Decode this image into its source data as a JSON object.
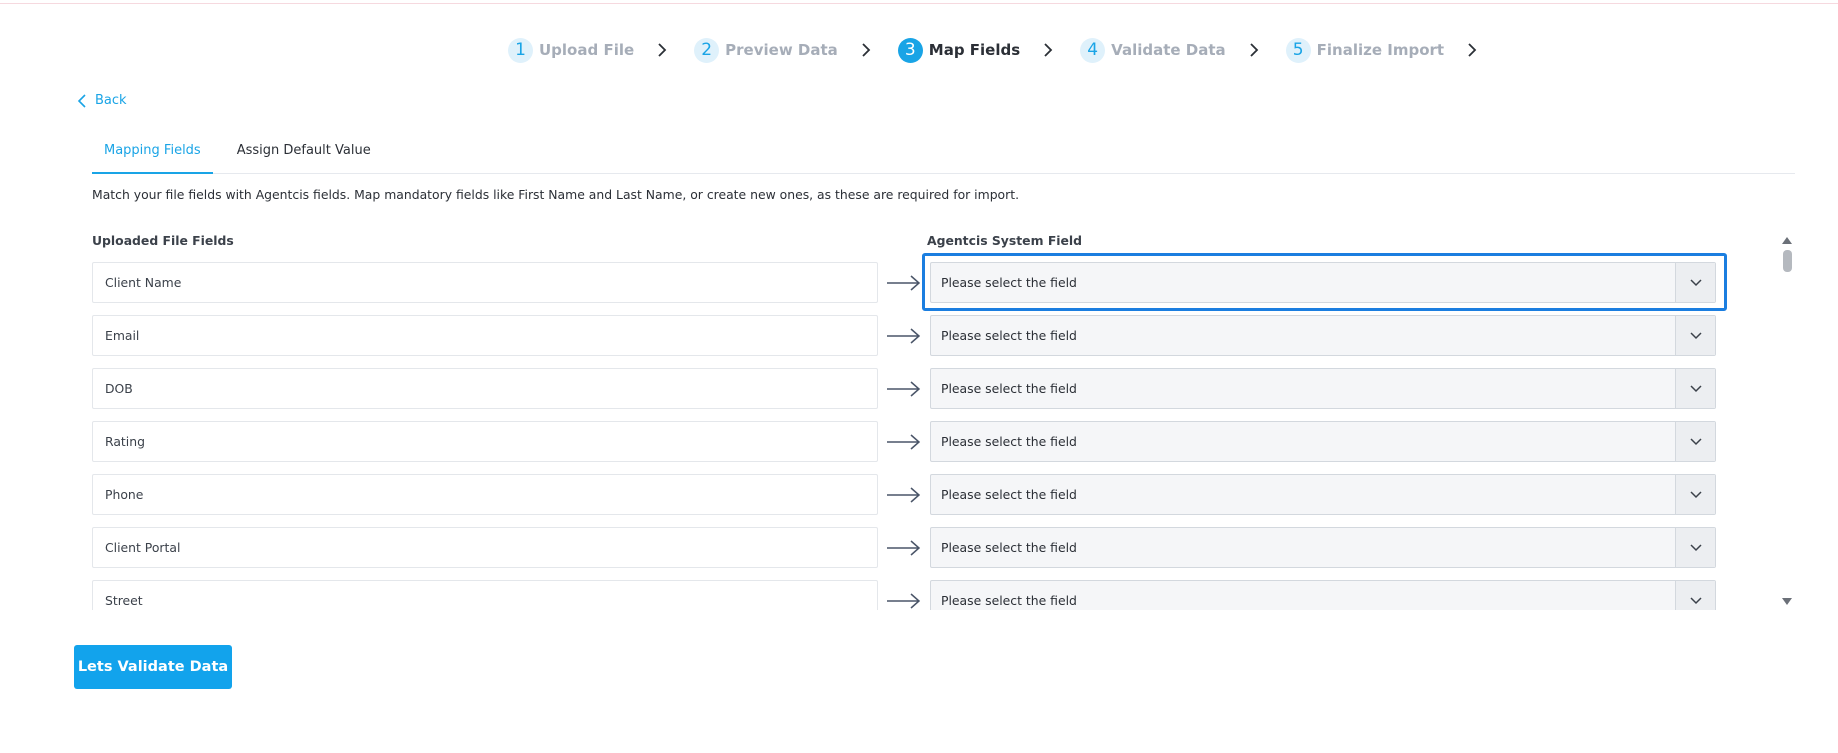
{
  "stepper": {
    "steps": [
      {
        "num": "1",
        "label": "Upload File"
      },
      {
        "num": "2",
        "label": "Preview Data"
      },
      {
        "num": "3",
        "label": "Map Fields"
      },
      {
        "num": "4",
        "label": "Validate Data"
      },
      {
        "num": "5",
        "label": "Finalize Import"
      }
    ],
    "active_step": 3
  },
  "back_label": "Back",
  "tabs": [
    {
      "label": "Mapping Fields"
    },
    {
      "label": "Assign Default Value"
    }
  ],
  "description": "Match your file fields with Agentcis fields. Map mandatory fields like First Name and Last Name, or create new ones, as these are required for import.",
  "columns": {
    "left": "Uploaded File Fields",
    "right": "Agentcis System Field"
  },
  "mappings": [
    {
      "source": "Client Name",
      "target": "Please select the field"
    },
    {
      "source": "Email",
      "target": "Please select the field"
    },
    {
      "source": "DOB",
      "target": "Please select the field"
    },
    {
      "source": "Rating",
      "target": "Please select the field"
    },
    {
      "source": "Phone",
      "target": "Please select the field"
    },
    {
      "source": "Client Portal",
      "target": "Please select the field"
    },
    {
      "source": "Street",
      "target": "Please select the field"
    }
  ],
  "primary_button": "Lets Validate Data",
  "colors": {
    "accent": "#19a4e6",
    "focus": "#1b7ee0",
    "button": "#12a3ec"
  }
}
